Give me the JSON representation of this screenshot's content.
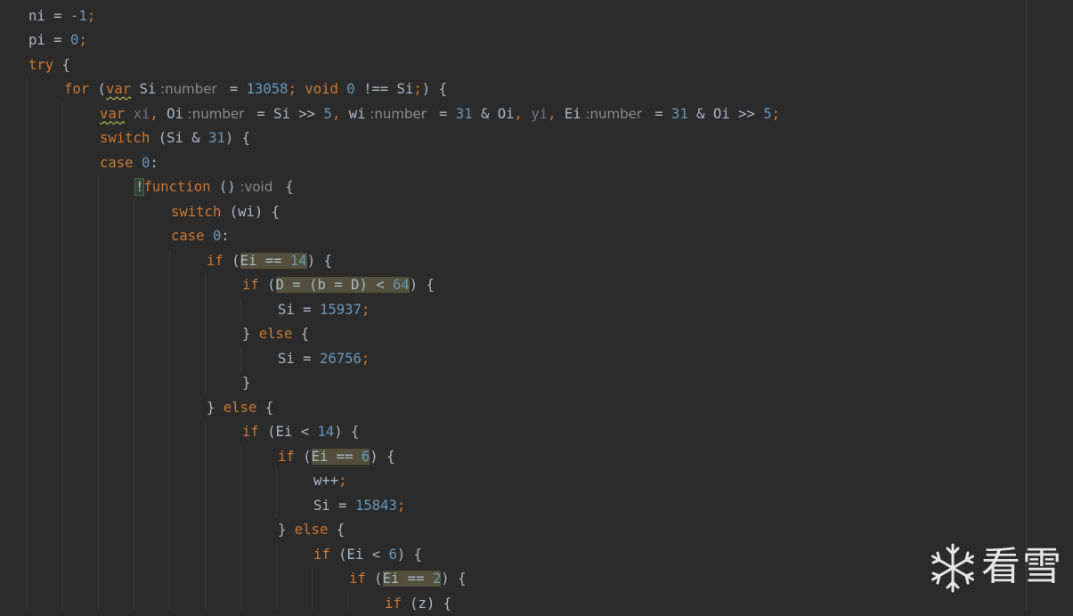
{
  "editor": {
    "lines": [
      {
        "indent": 0,
        "tokens": [
          {
            "t": "ni",
            "c": "t-id"
          },
          {
            "t": " = ",
            "c": "t-id"
          },
          {
            "t": "-1",
            "c": "t-num"
          },
          {
            "t": ";",
            "c": "t-punc"
          }
        ]
      },
      {
        "indent": 0,
        "tokens": [
          {
            "t": "pi",
            "c": "t-id"
          },
          {
            "t": " = ",
            "c": "t-id"
          },
          {
            "t": "0",
            "c": "t-num"
          },
          {
            "t": ";",
            "c": "t-punc"
          }
        ]
      },
      {
        "indent": 0,
        "tokens": [
          {
            "t": "try",
            "c": "t-kw"
          },
          {
            "t": " {",
            "c": "t-id"
          }
        ]
      },
      {
        "indent": 1,
        "tokens": [
          {
            "t": "for",
            "c": "t-kw"
          },
          {
            "t": " (",
            "c": "t-id"
          },
          {
            "t": "var",
            "c": "t-kw t-squig"
          },
          {
            "t": " Si",
            "c": "t-id"
          },
          {
            "t": " :number ",
            "c": "t-hint"
          },
          {
            "t": " = ",
            "c": "t-id"
          },
          {
            "t": "13058",
            "c": "t-num"
          },
          {
            "t": "; ",
            "c": "t-punc"
          },
          {
            "t": "void ",
            "c": "t-kw"
          },
          {
            "t": "0",
            "c": "t-num"
          },
          {
            "t": " !== Si",
            "c": "t-id"
          },
          {
            "t": ";",
            "c": "t-punc"
          },
          {
            "t": ") {",
            "c": "t-id"
          }
        ]
      },
      {
        "indent": 2,
        "tokens": [
          {
            "t": "var",
            "c": "t-kw t-squig"
          },
          {
            "t": " ",
            "c": "t-id"
          },
          {
            "t": "xi",
            "c": "t-unused"
          },
          {
            "t": ", ",
            "c": "t-punc"
          },
          {
            "t": "Oi",
            "c": "t-id"
          },
          {
            "t": " :number ",
            "c": "t-hint"
          },
          {
            "t": " = Si >> ",
            "c": "t-id"
          },
          {
            "t": "5",
            "c": "t-num"
          },
          {
            "t": ", ",
            "c": "t-punc"
          },
          {
            "t": "wi",
            "c": "t-id"
          },
          {
            "t": " :number ",
            "c": "t-hint"
          },
          {
            "t": " = ",
            "c": "t-id"
          },
          {
            "t": "31",
            "c": "t-num"
          },
          {
            "t": " & Oi",
            "c": "t-id"
          },
          {
            "t": ", ",
            "c": "t-punc"
          },
          {
            "t": "yi",
            "c": "t-unused"
          },
          {
            "t": ", ",
            "c": "t-punc"
          },
          {
            "t": "Ei",
            "c": "t-id"
          },
          {
            "t": " :number ",
            "c": "t-hint"
          },
          {
            "t": " = ",
            "c": "t-id"
          },
          {
            "t": "31",
            "c": "t-num"
          },
          {
            "t": " & Oi >> ",
            "c": "t-id"
          },
          {
            "t": "5",
            "c": "t-num"
          },
          {
            "t": ";",
            "c": "t-punc"
          }
        ]
      },
      {
        "indent": 2,
        "tokens": [
          {
            "t": "switch",
            "c": "t-kw"
          },
          {
            "t": " (Si & ",
            "c": "t-id"
          },
          {
            "t": "31",
            "c": "t-num"
          },
          {
            "t": ") {",
            "c": "t-id"
          }
        ]
      },
      {
        "indent": 2,
        "tokens": [
          {
            "t": "case ",
            "c": "t-kw"
          },
          {
            "t": "0",
            "c": "t-num"
          },
          {
            "t": ":",
            "c": "t-id"
          }
        ]
      },
      {
        "indent": 3,
        "tokens": [
          {
            "t": "!",
            "c": "t-id bang"
          },
          {
            "t": "function",
            "c": "t-kw"
          },
          {
            "t": " ()",
            "c": "t-id"
          },
          {
            "t": " :void ",
            "c": "t-hint"
          },
          {
            "t": " {",
            "c": "t-id"
          }
        ]
      },
      {
        "indent": 4,
        "tokens": [
          {
            "t": "switch",
            "c": "t-kw"
          },
          {
            "t": " (wi) {",
            "c": "t-id"
          }
        ]
      },
      {
        "indent": 4,
        "tokens": [
          {
            "t": "case ",
            "c": "t-kw"
          },
          {
            "t": "0",
            "c": "t-num"
          },
          {
            "t": ":",
            "c": "t-id"
          }
        ]
      },
      {
        "indent": 5,
        "tokens": [
          {
            "t": "if",
            "c": "t-kw"
          },
          {
            "t": " (",
            "c": "t-id"
          },
          {
            "t": "Ei == ",
            "c": "t-id hl"
          },
          {
            "t": "14",
            "c": "t-num hl"
          },
          {
            "t": ") {",
            "c": "t-id"
          }
        ]
      },
      {
        "indent": 6,
        "tokens": [
          {
            "t": "if",
            "c": "t-kw"
          },
          {
            "t": " (",
            "c": "t-id"
          },
          {
            "t": "D = (b = D) < ",
            "c": "t-id hl"
          },
          {
            "t": "64",
            "c": "t-num hl"
          },
          {
            "t": ") {",
            "c": "t-id"
          }
        ]
      },
      {
        "indent": 7,
        "tokens": [
          {
            "t": "Si = ",
            "c": "t-id"
          },
          {
            "t": "15937",
            "c": "t-num"
          },
          {
            "t": ";",
            "c": "t-punc"
          }
        ]
      },
      {
        "indent": 6,
        "tokens": [
          {
            "t": "} ",
            "c": "t-id"
          },
          {
            "t": "else",
            "c": "t-kw"
          },
          {
            "t": " {",
            "c": "t-id"
          }
        ]
      },
      {
        "indent": 7,
        "tokens": [
          {
            "t": "Si = ",
            "c": "t-id"
          },
          {
            "t": "26756",
            "c": "t-num"
          },
          {
            "t": ";",
            "c": "t-punc"
          }
        ]
      },
      {
        "indent": 6,
        "tokens": [
          {
            "t": "}",
            "c": "t-id"
          }
        ]
      },
      {
        "indent": 5,
        "tokens": [
          {
            "t": "} ",
            "c": "t-id"
          },
          {
            "t": "else",
            "c": "t-kw"
          },
          {
            "t": " {",
            "c": "t-id"
          }
        ]
      },
      {
        "indent": 6,
        "tokens": [
          {
            "t": "if",
            "c": "t-kw"
          },
          {
            "t": " (Ei < ",
            "c": "t-id"
          },
          {
            "t": "14",
            "c": "t-num"
          },
          {
            "t": ") {",
            "c": "t-id"
          }
        ]
      },
      {
        "indent": 7,
        "tokens": [
          {
            "t": "if",
            "c": "t-kw"
          },
          {
            "t": " (",
            "c": "t-id"
          },
          {
            "t": "Ei == ",
            "c": "t-id hl"
          },
          {
            "t": "6",
            "c": "t-num hl"
          },
          {
            "t": ") {",
            "c": "t-id"
          }
        ]
      },
      {
        "indent": 8,
        "tokens": [
          {
            "t": "w++",
            "c": "t-id"
          },
          {
            "t": ";",
            "c": "t-punc"
          }
        ]
      },
      {
        "indent": 8,
        "tokens": [
          {
            "t": "Si = ",
            "c": "t-id"
          },
          {
            "t": "15843",
            "c": "t-num"
          },
          {
            "t": ";",
            "c": "t-punc"
          }
        ]
      },
      {
        "indent": 7,
        "tokens": [
          {
            "t": "} ",
            "c": "t-id"
          },
          {
            "t": "else",
            "c": "t-kw"
          },
          {
            "t": " {",
            "c": "t-id"
          }
        ]
      },
      {
        "indent": 8,
        "tokens": [
          {
            "t": "if",
            "c": "t-kw"
          },
          {
            "t": " (Ei < ",
            "c": "t-id"
          },
          {
            "t": "6",
            "c": "t-num"
          },
          {
            "t": ") {",
            "c": "t-id"
          }
        ]
      },
      {
        "indent": 9,
        "tokens": [
          {
            "t": "if",
            "c": "t-kw"
          },
          {
            "t": " (",
            "c": "t-id"
          },
          {
            "t": "Ei == ",
            "c": "t-id hl"
          },
          {
            "t": "2",
            "c": "t-num hl"
          },
          {
            "t": ") {",
            "c": "t-id"
          }
        ]
      },
      {
        "indent": 10,
        "tokens": [
          {
            "t": "if",
            "c": "t-kw"
          },
          {
            "t": " (z) {",
            "c": "t-id"
          }
        ]
      }
    ]
  },
  "watermark": {
    "icon": "snowflake-icon",
    "text": "看雪"
  }
}
